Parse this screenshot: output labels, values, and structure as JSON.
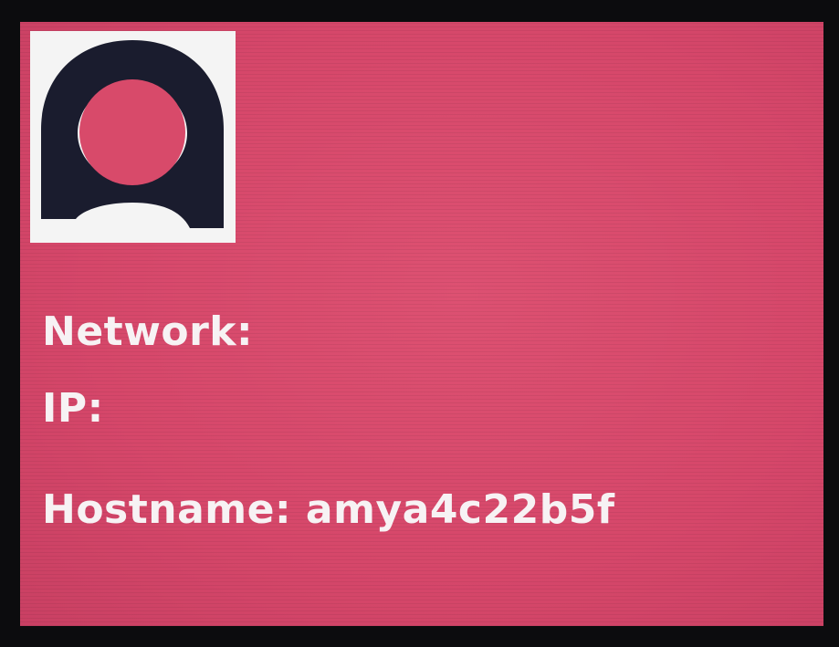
{
  "display": {
    "background_color": "#d84a6a",
    "text_color": "#f7f2f4",
    "logo": {
      "icon": "amy-logo-icon",
      "foreground": "#1a1c2e",
      "background": "#f4f4f4"
    },
    "network_label": "Network:",
    "ip_label": "IP:",
    "hostname_label": "Hostname:",
    "hostname_value": "amya4c22b5f"
  }
}
